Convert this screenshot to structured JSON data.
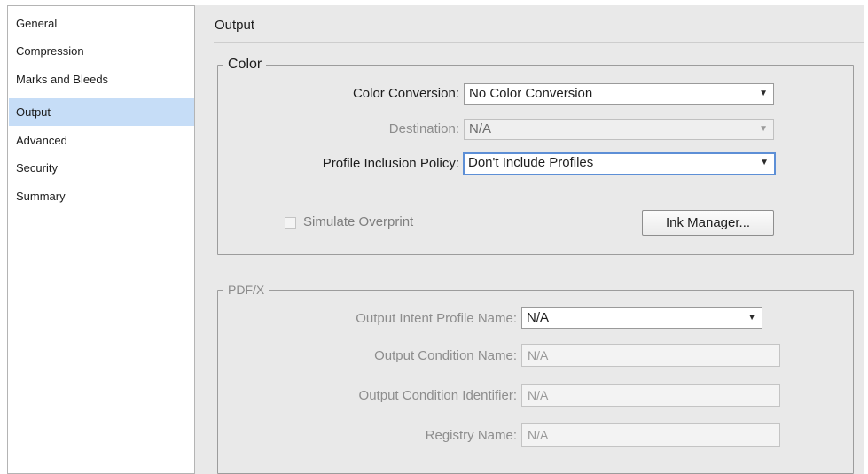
{
  "sidebar": {
    "items": [
      {
        "label": "General",
        "selected": false
      },
      {
        "label": "Compression",
        "selected": false
      },
      {
        "label": "Marks and Bleeds",
        "selected": false
      },
      {
        "label": "Output",
        "selected": true
      },
      {
        "label": "Advanced",
        "selected": false
      },
      {
        "label": "Security",
        "selected": false
      },
      {
        "label": "Summary",
        "selected": false
      }
    ]
  },
  "section": {
    "title": "Output"
  },
  "color_group": {
    "legend": "Color",
    "color_conversion": {
      "label": "Color Conversion:",
      "value": "No Color Conversion"
    },
    "destination": {
      "label": "Destination:",
      "value": "N/A"
    },
    "profile_inclusion": {
      "label": "Profile Inclusion Policy:",
      "value": "Don't Include Profiles"
    },
    "simulate_overprint": {
      "label": "Simulate Overprint",
      "checked": false
    },
    "ink_manager_label": "Ink Manager..."
  },
  "pdfx_group": {
    "legend": "PDF/X",
    "output_intent": {
      "label": "Output Intent Profile Name:",
      "value": "N/A"
    },
    "output_condition_name": {
      "label": "Output Condition Name:",
      "value": "N/A"
    },
    "output_condition_identifier": {
      "label": "Output Condition Identifier:",
      "value": "N/A"
    },
    "registry_name": {
      "label": "Registry Name:",
      "value": "N/A"
    }
  },
  "icons": {
    "dropdown_arrow": "▼"
  },
  "colors": {
    "selection": "#c6ddf7",
    "focus": "#5d8fd6",
    "panel": "#e9e9e9"
  }
}
